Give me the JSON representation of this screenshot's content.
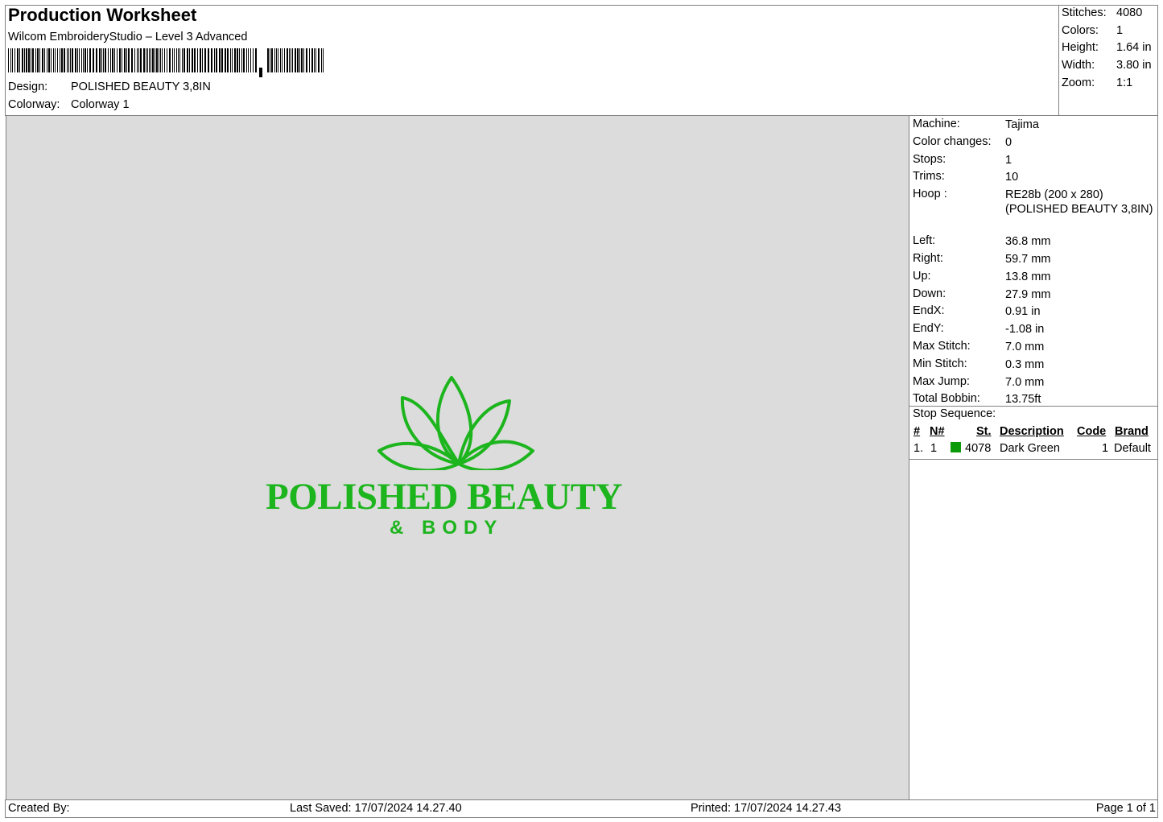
{
  "header": {
    "title": "Production Worksheet",
    "software": "Wilcom EmbroideryStudio – Level 3 Advanced",
    "design_label": "Design:",
    "design_value": "POLISHED BEAUTY 3,8IN",
    "colorway_label": "Colorway:",
    "colorway_value": "Colorway 1"
  },
  "summary": {
    "stitches_label": "Stitches:",
    "stitches_value": "4080",
    "colors_label": "Colors:",
    "colors_value": "1",
    "height_label": "Height:",
    "height_value": "1.64 in",
    "width_label": "Width:",
    "width_value": "3.80 in",
    "zoom_label": "Zoom:",
    "zoom_value": "1:1"
  },
  "design_preview": {
    "logo_line1": "POLISHED BEAUTY",
    "logo_line2": "& BODY",
    "thread_color": "#1db51d"
  },
  "machine_info": {
    "rows": [
      {
        "label": "Machine:",
        "value": "Tajima"
      },
      {
        "label": "Color changes:",
        "value": "0"
      },
      {
        "label": "Stops:",
        "value": "1"
      },
      {
        "label": "Trims:",
        "value": "10"
      },
      {
        "label": "Hoop :",
        "value": "RE28b (200 x 280) (POLISHED BEAUTY 3,8IN)"
      },
      {
        "label": "Left:",
        "value": "36.8 mm"
      },
      {
        "label": "Right:",
        "value": "59.7 mm"
      },
      {
        "label": "Up:",
        "value": "13.8 mm"
      },
      {
        "label": "Down:",
        "value": "27.9 mm"
      },
      {
        "label": "EndX:",
        "value": "0.91 in"
      },
      {
        "label": "EndY:",
        "value": "-1.08 in"
      },
      {
        "label": "Max Stitch:",
        "value": "7.0 mm"
      },
      {
        "label": "Min Stitch:",
        "value": "0.3 mm"
      },
      {
        "label": "Max Jump:",
        "value": "7.0 mm"
      },
      {
        "label": "Total Bobbin:",
        "value": "13.75ft"
      }
    ]
  },
  "stop_sequence": {
    "title": "Stop Sequence:",
    "headers": {
      "num": "#",
      "needle": "N#",
      "st": "St.",
      "description": "Description",
      "code": "Code",
      "brand": "Brand"
    },
    "rows": [
      {
        "num": "1.",
        "needle": "1",
        "swatch_color": "#0a9a0a",
        "st": "4078",
        "description": "Dark Green",
        "code": "1",
        "brand": "Default"
      }
    ]
  },
  "footer": {
    "created_by": "Created By:",
    "last_saved": "Last Saved: 17/07/2024 14.27.40",
    "printed": "Printed: 17/07/2024 14.27.43",
    "page": "Page 1 of 1"
  }
}
